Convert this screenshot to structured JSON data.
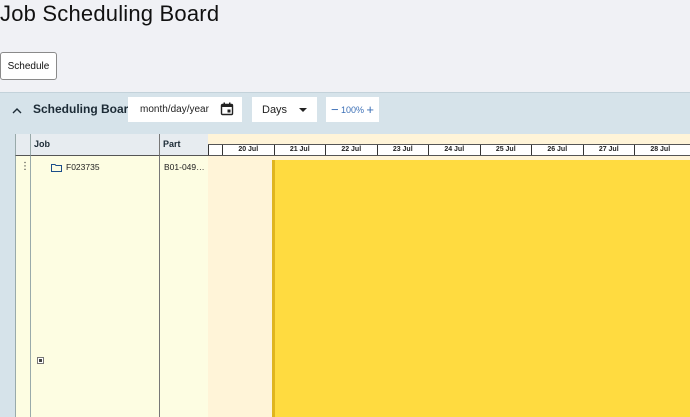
{
  "page": {
    "title": "Job Scheduling Board"
  },
  "toolbar": {
    "schedule_label": "Schedule"
  },
  "board": {
    "title": "Scheduling Board",
    "date_placeholder": "month/day/year",
    "view_mode": "Days",
    "zoom_level": "100%"
  },
  "grid": {
    "columns": {
      "job": "Job",
      "part": "Part"
    },
    "rows": [
      {
        "job": "F023735",
        "part": "B01-049…"
      }
    ]
  },
  "timeline": {
    "days": [
      "20 Jul",
      "21 Jul",
      "22 Jul",
      "23 Jul",
      "24 Jul",
      "25 Jul",
      "26 Jul",
      "27 Jul",
      "28 Jul"
    ]
  },
  "colors": {
    "bar": "#ffdb40",
    "row_bg": "#fdfde2",
    "header_bg": "#d6e3ea"
  },
  "icons": {
    "collapse": "chevron-up-icon",
    "calendar": "calendar-icon",
    "folder": "folder-icon",
    "drag": "more-vertical-icon"
  }
}
